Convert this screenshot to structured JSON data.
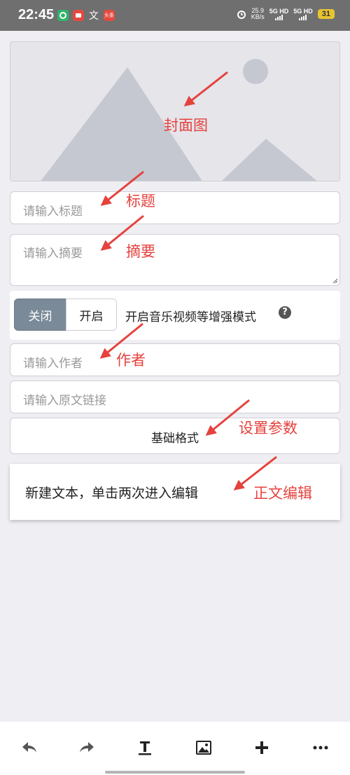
{
  "status_bar": {
    "time": "22:45",
    "network_speed": "25.9",
    "network_unit": "KB/s",
    "signal_1": "5G HD",
    "signal_2": "5G HD",
    "battery": "31",
    "app_icons": [
      "green-app-icon",
      "red-app-icon",
      "text-app-icon",
      "news-app-icon"
    ],
    "app_glyph_3": "文",
    "app_glyph_4": "头条"
  },
  "editor": {
    "title_placeholder": "请输入标题",
    "summary_placeholder": "请输入摘要",
    "toggle_off_label": "关闭",
    "toggle_on_label": "开启",
    "toggle_selected": "关闭",
    "toggle_description": "开启音乐视频等增强模式",
    "author_placeholder": "请输入作者",
    "source_url_placeholder": "请输入原文链接",
    "format_button_label": "基础格式",
    "body_text": "新建文本，单击两次进入编辑"
  },
  "annotations": {
    "cover": "封面图",
    "title": "标题",
    "summary": "摘要",
    "author": "作者",
    "settings": "设置参数",
    "body": "正文编辑"
  },
  "toolbar": {
    "items": [
      "undo-icon",
      "redo-icon",
      "text-format-icon",
      "image-icon",
      "add-icon",
      "more-icon"
    ]
  },
  "colors": {
    "annotation": "#e5423e",
    "toggle_selected_bg": "#7a8a98",
    "page_bg": "#efeef3"
  }
}
